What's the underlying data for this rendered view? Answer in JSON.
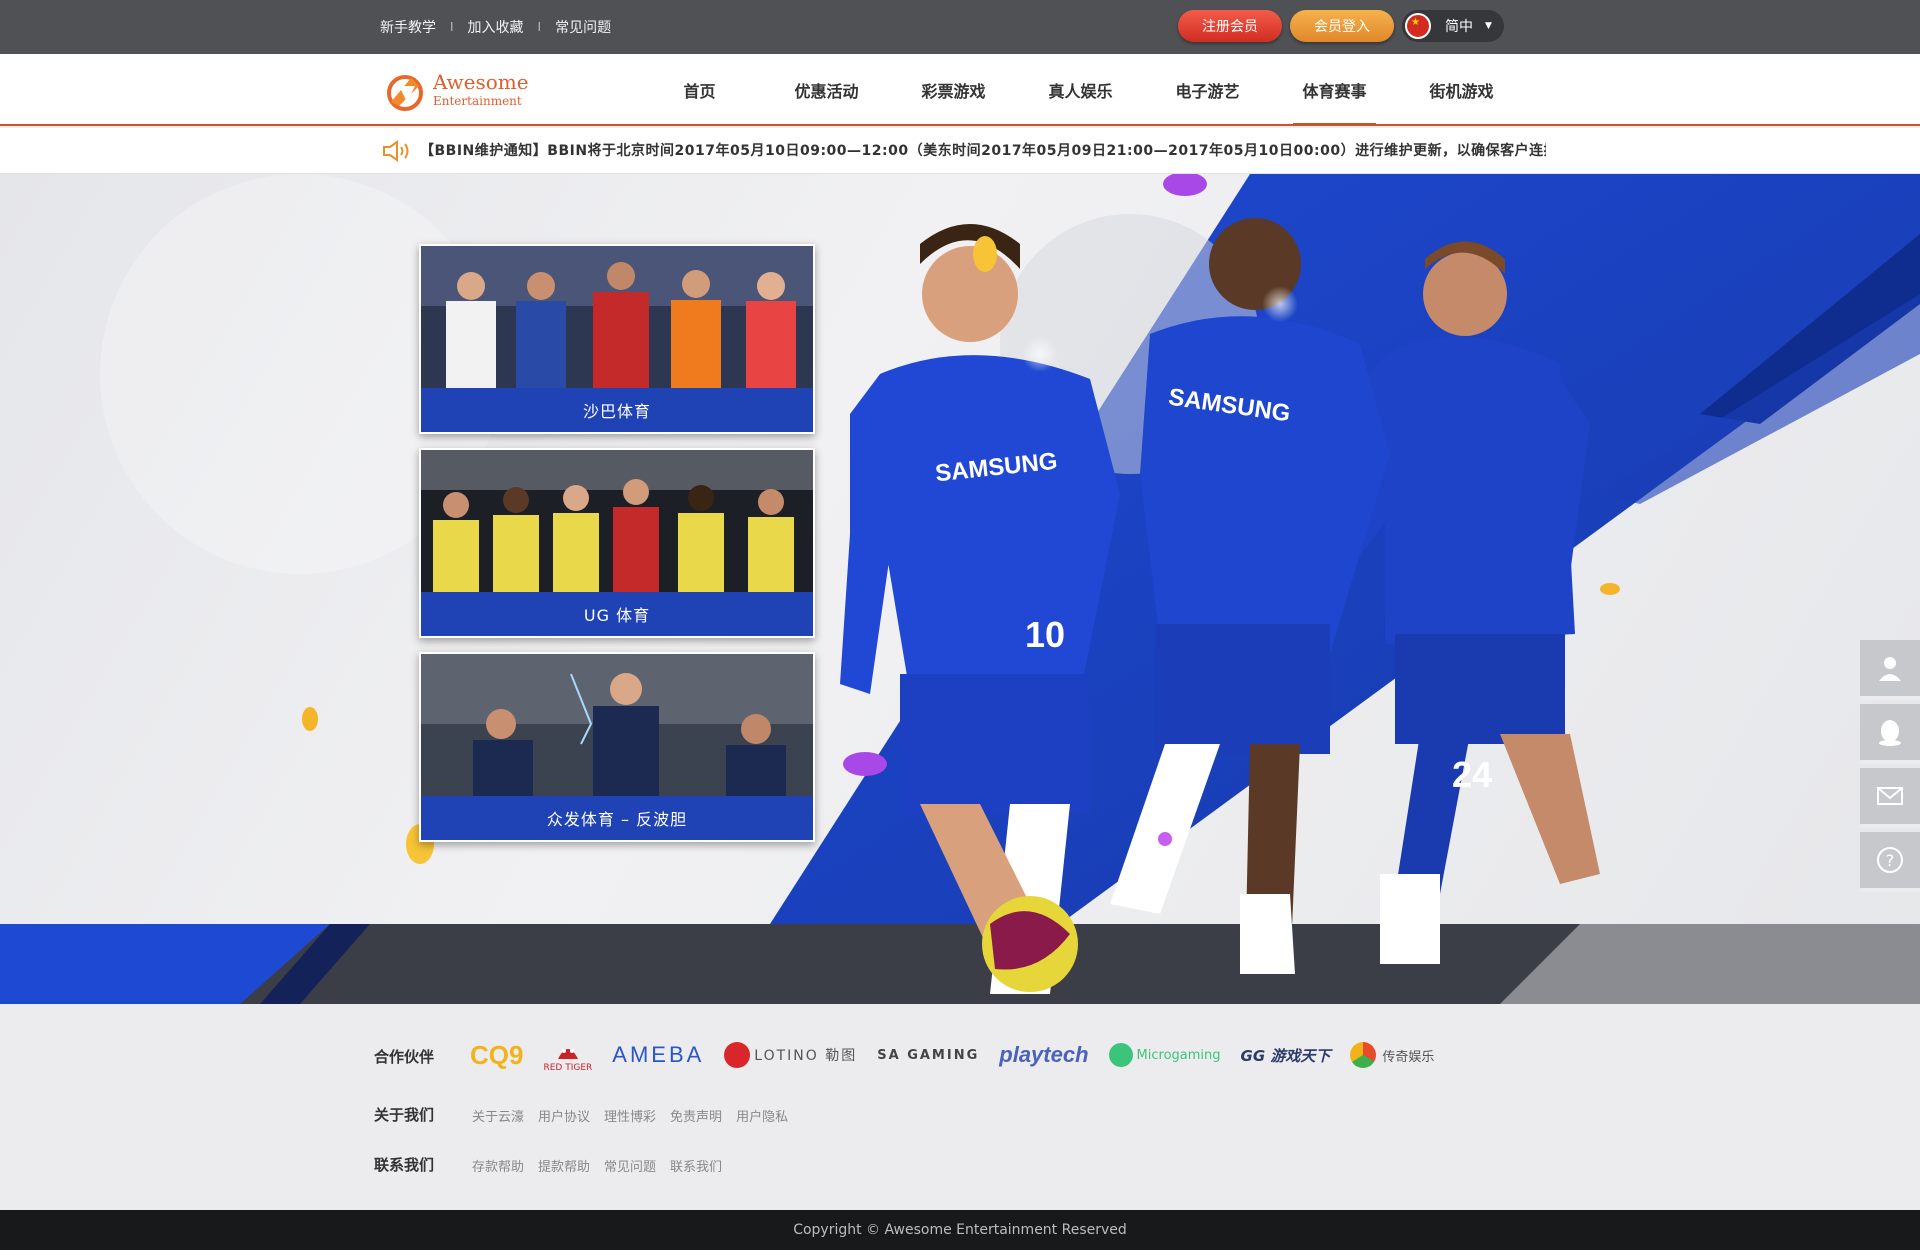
{
  "top_links": [
    "新手教学",
    "加入收藏",
    "常见问题"
  ],
  "top_separator": "I",
  "account": {
    "register_label": "注册会员",
    "login_label": "会员登入",
    "language": "简中"
  },
  "brand": {
    "line1": "Awesome",
    "line2": "Entertainment"
  },
  "nav": {
    "items": [
      {
        "label": "首页"
      },
      {
        "label": "优惠活动"
      },
      {
        "label": "彩票游戏"
      },
      {
        "label": "真人娱乐"
      },
      {
        "label": "电子游艺"
      },
      {
        "label": "体育赛事"
      },
      {
        "label": "街机游戏"
      }
    ],
    "active": "体育赛事"
  },
  "notice": "【BBIN维护通知】BBIN将于北京时间2017年05月10日09:00—12:00（美东时间2017年05月09日21:00—2017年05月10日00:00）进行维护更新，以确保客户连接",
  "games": [
    {
      "label": "沙巴体育"
    },
    {
      "label": "UG 体育"
    },
    {
      "label": "众发体育 – 反波胆"
    }
  ],
  "banner_text": {
    "jersey_sponsor": "SAMSUNG",
    "number_left": "10",
    "number_right": "24"
  },
  "footer": {
    "partners_label": "合作伙伴",
    "partners": [
      "CQ9",
      "RED TIGER",
      "AMEBA",
      "LOTINO 勒图",
      "SA GAMING",
      "playtech",
      "Microgaming",
      "GG 游戏天下",
      "传奇娱乐"
    ],
    "about_label": "关于我们",
    "about_links": [
      "关于云濠",
      "用户协议",
      "理性博彩",
      "免责声明",
      "用户隐私"
    ],
    "contact_label": "联系我们",
    "contact_links": [
      "存款帮助",
      "提款帮助",
      "常见问题",
      "联系我们"
    ]
  },
  "side_tools": [
    "user-service-icon",
    "qq-icon",
    "mail-icon",
    "help-icon"
  ],
  "copyright": "Copyright © Awesome Entertainment Reserved",
  "colors": {
    "accent": "#c8552a",
    "card_label_bg": "#1f42b4",
    "topbar": "#4f5154",
    "register": "#d12d22",
    "login": "#e1872a"
  }
}
